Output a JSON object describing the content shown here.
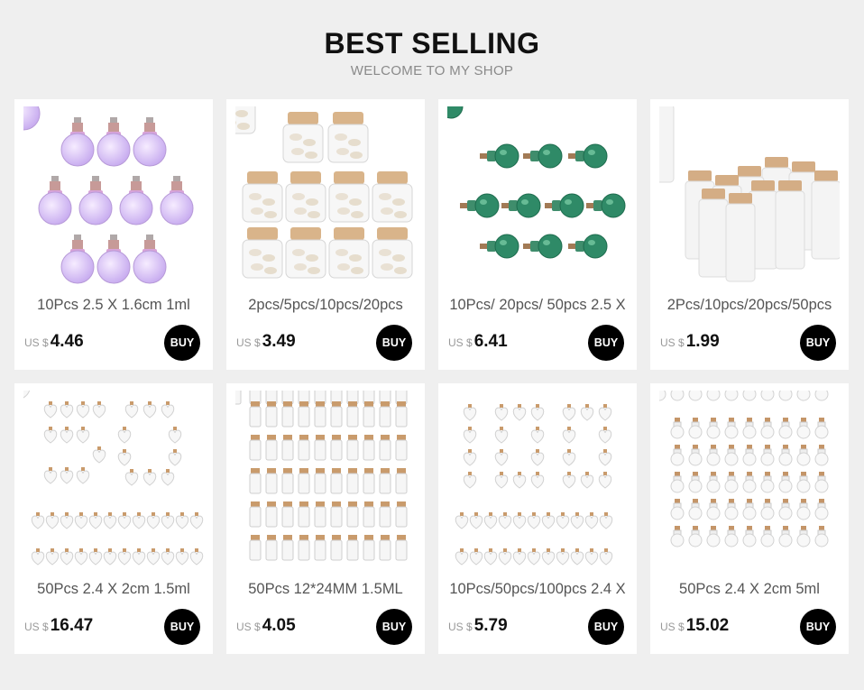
{
  "header": {
    "title": "BEST SELLING",
    "subtitle": "WELCOME TO MY SHOP"
  },
  "currency_prefix": "US $",
  "buy_label": "BUY",
  "products": [
    {
      "name": "10Pcs 2.5 X 1.6cm 1ml",
      "price": "4.46"
    },
    {
      "name": "2pcs/5pcs/10pcs/20pcs",
      "price": "3.49"
    },
    {
      "name": "10Pcs/ 20pcs/ 50pcs 2.5 X",
      "price": "6.41"
    },
    {
      "name": "2Pcs/10pcs/20pcs/50pcs",
      "price": "1.99"
    },
    {
      "name": "50Pcs 2.4 X 2cm 1.5ml",
      "price": "16.47"
    },
    {
      "name": "50Pcs 12*24MM 1.5ML",
      "price": "4.05"
    },
    {
      "name": "10Pcs/50pcs/100pcs 2.4 X",
      "price": "5.79"
    },
    {
      "name": "50Pcs 2.4 X 2cm 5ml",
      "price": "15.02"
    }
  ]
}
